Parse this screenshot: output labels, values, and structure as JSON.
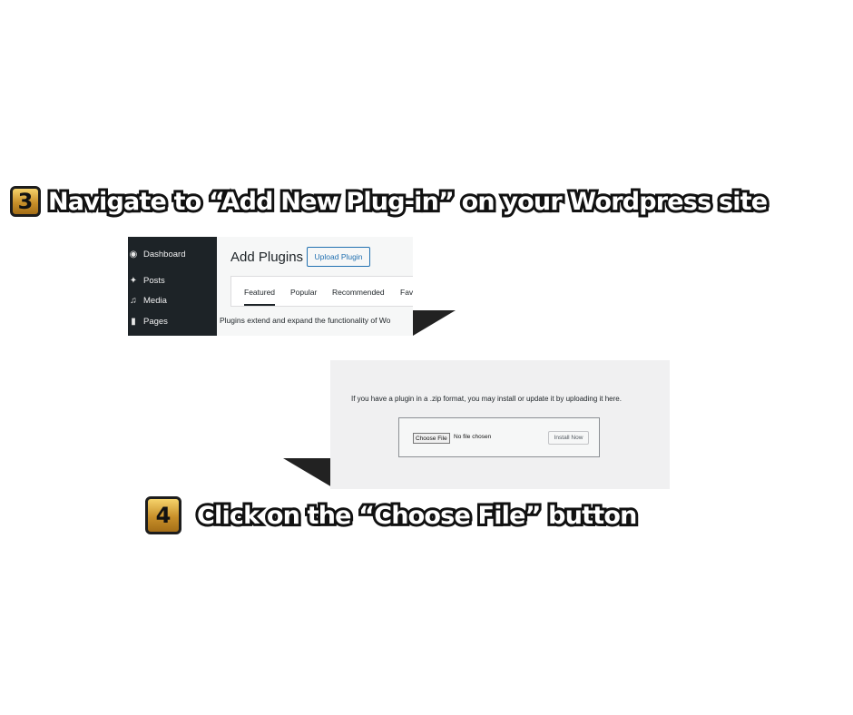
{
  "step3": {
    "number": "3",
    "text": "Navigate to “Add New Plug-in” on your Wordpress site"
  },
  "step4": {
    "number": "4",
    "text": "Click on the “Choose File” button"
  },
  "wp_admin": {
    "menu": [
      {
        "label": "Dashboard",
        "icon": "dashboard-icon"
      },
      {
        "label": "Posts",
        "icon": "pin-icon"
      },
      {
        "label": "Media",
        "icon": "media-icon"
      },
      {
        "label": "Pages",
        "icon": "pages-icon"
      }
    ],
    "page_title": "Add Plugins",
    "upload_button": "Upload Plugin",
    "tabs": [
      "Featured",
      "Popular",
      "Recommended",
      "Fav"
    ],
    "description": "Plugins extend and expand the functionality of Wo"
  },
  "upload_panel": {
    "note": "If you have a plugin in a .zip format, you may install or update it by uploading it here.",
    "choose_file": "Choose File",
    "no_file": "No file chosen",
    "install_button": "Install Now"
  },
  "colors": {
    "sidebar_bg": "#1d2327",
    "accent": "#2271b1",
    "badge_gold": "#c8902a"
  }
}
